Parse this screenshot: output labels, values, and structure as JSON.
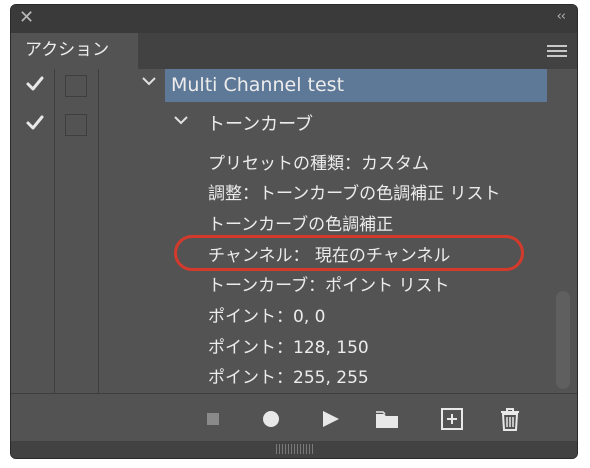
{
  "panel": {
    "tab_label": "アクション"
  },
  "actions": [
    {
      "type": "action",
      "title": "Multi Channel test",
      "checked": true,
      "expanded": true,
      "selected": true
    },
    {
      "type": "step",
      "title": "トーンカーブ",
      "checked": true,
      "expanded": true
    },
    {
      "type": "detail",
      "text": "プリセットの種類：カスタム"
    },
    {
      "type": "detail",
      "text": "調整：トーンカーブの色調補正 リスト"
    },
    {
      "type": "detail",
      "text": "トーンカーブの色調補正"
    },
    {
      "type": "detail",
      "text": "チャンネル： 現在のチャンネル",
      "highlighted": true
    },
    {
      "type": "detail",
      "text": "トーンカーブ：ポイント リスト"
    },
    {
      "type": "detail",
      "text": "ポイント：0, 0"
    },
    {
      "type": "detail",
      "text": "ポイント：128, 150"
    },
    {
      "type": "detail",
      "text": "ポイント：255, 255"
    }
  ],
  "toolbar": {
    "buttons": [
      "stop-icon",
      "record-icon",
      "play-icon",
      "new-set-folder-icon",
      "new-action-icon",
      "delete-icon"
    ]
  },
  "colors": {
    "panel_bg": "#535353",
    "selection": "#5e7897",
    "highlight_ring": "#d33a2c",
    "text": "#ececec"
  }
}
